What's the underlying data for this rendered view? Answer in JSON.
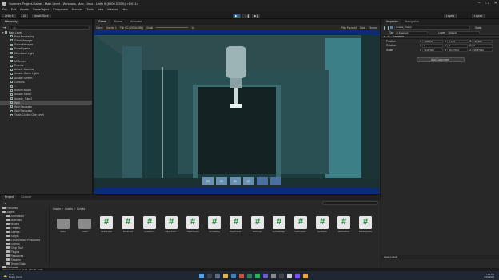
{
  "window": {
    "title": "Summer-Project-Game - Main Level - Windows, Mac, Linux - Unity 6 (6000.0.25f1) <DX11>",
    "controls": [
      "–",
      "□",
      "✕"
    ]
  },
  "menu": [
    "File",
    "Edit",
    "Assets",
    "GameObject",
    "Component",
    "Services",
    "Tools",
    "Jobs",
    "Window",
    "Help"
  ],
  "toolbar": {
    "account": "Unity 6",
    "ai": "AI",
    "asset_store": "Asset Store",
    "layers": "Layers",
    "layout": "Layout"
  },
  "hierarchy": {
    "tab": "Hierarchy",
    "search_placeholder": "All",
    "root": "Main Level",
    "items": [
      "Post Processing",
      "GameManager",
      "SoundManager",
      "EventSystem",
      "Directional Light",
      "...",
      "UI Terrain",
      "Exterior",
      "Arcade Machine",
      "Arcade Game Lights",
      "Arcade Screen",
      "Controls",
      "...",
      "Bottom Board",
      "Arcade Stand",
      "Arcade_Tube2",
      "Wall",
      "Wall Separator",
      "Wall Separator",
      "Trash Control One Level"
    ],
    "selected_index": 16
  },
  "scene": {
    "tabs": [
      "Game",
      "Scene",
      "Animator"
    ],
    "active_tab": 0,
    "game_bar": [
      "Game",
      "Display 1",
      "Full HD (1920x1080)",
      "Scale",
      "1x",
      "Play Focused",
      "Stats",
      "Gizmos"
    ],
    "hud_buttons": [
      "Lin",
      "Lin",
      "Lin",
      "Lin"
    ]
  },
  "inspector": {
    "tabs": [
      "Inspector",
      "Navigation"
    ],
    "object_name": "Arcade_Tube2",
    "static_label": "Static",
    "tag_label": "Tag",
    "tag_value": "Untagged",
    "layer_label": "Layer",
    "layer_value": "Default",
    "component": "Transform",
    "rows": [
      {
        "label": "Position",
        "x": "-235.672",
        "y": "7.185",
        "z": "-32.984"
      },
      {
        "label": "Rotation",
        "x": "0",
        "y": "0",
        "z": "0"
      },
      {
        "label": "Scale",
        "x": "36.87024",
        "y": "36.87024",
        "z": "36.87024"
      }
    ],
    "add_component": "Add Component",
    "footer": "Asset Labels"
  },
  "project": {
    "tabs": [
      "Project",
      "Console"
    ],
    "breadcrumb": [
      "Assets",
      "Assets",
      "Scripts"
    ],
    "tree": [
      "Favorites",
      "Assets",
      "Animations",
      "Materials",
      "Models",
      "Prefabs",
      "Scenes",
      "Scripts",
      "Editor Default Resources",
      "Gizmos",
      "Shop Stuff",
      "Plugins",
      "Resources",
      "Shaders",
      "Terrain Data",
      "Packages"
    ],
    "assets": [
      {
        "name": "Editor",
        "type": "folder"
      },
      {
        "name": "Folder",
        "type": "folder"
      },
      {
        "name": "ButtonLabel",
        "type": "script"
      },
      {
        "name": "Movement",
        "type": "script"
      },
      {
        "name": "ArcadeCo...",
        "type": "script"
      },
      {
        "name": "PlayerCont...",
        "type": "script"
      },
      {
        "name": "PlayerSound",
        "type": "script"
      },
      {
        "name": "PauseMenu",
        "type": "script"
      },
      {
        "name": "PlayerCame...",
        "type": "script"
      },
      {
        "name": "HudScript",
        "type": "script"
      },
      {
        "name": "ScoreManag...",
        "type": "script"
      },
      {
        "name": "TrashSpawn...",
        "type": "script"
      },
      {
        "name": "NewMenu",
        "type": "script"
      },
      {
        "name": "ButtonMove",
        "type": "script"
      },
      {
        "name": "WallSeparator",
        "type": "script"
      }
    ]
  },
  "status": "Camera Rotation: (0.00, 270.00, 0.00)",
  "taskbar": {
    "weather_temp": "78°F",
    "weather_desc": "Mostly cloudy",
    "time": "7:45 PM",
    "date": "6/15/2025"
  },
  "colors": {
    "accent": "#2c5d87",
    "viewport_bg": "#0a2a7a",
    "panel": "#282828"
  }
}
